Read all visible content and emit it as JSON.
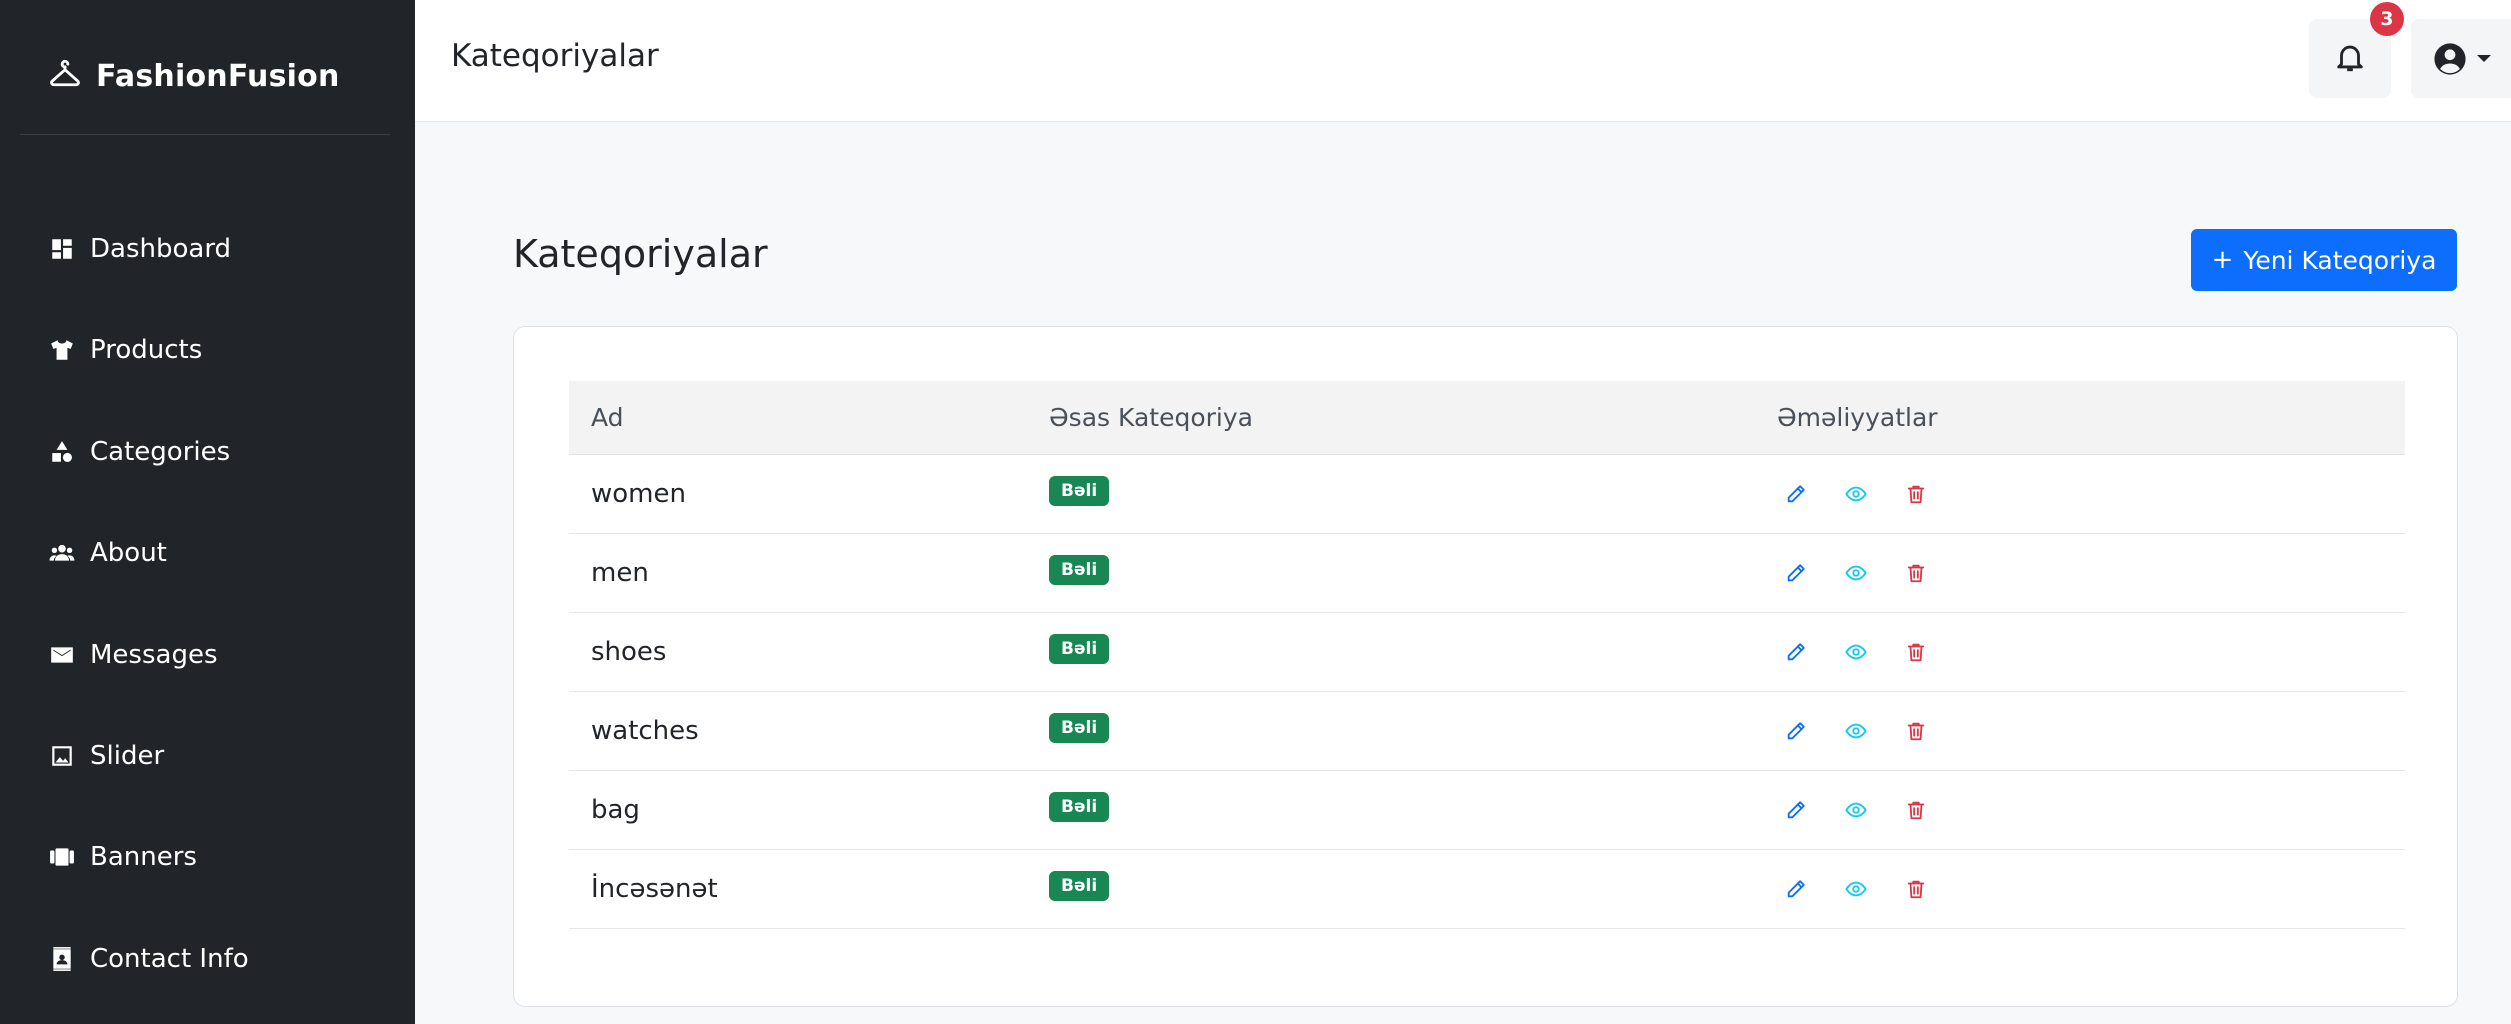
{
  "brand": {
    "name": "FashionFusion"
  },
  "sidebar": {
    "items": [
      {
        "label": "Dashboard",
        "icon": "dashboard-icon"
      },
      {
        "label": "Products",
        "icon": "shirt-icon"
      },
      {
        "label": "Categories",
        "icon": "shapes-icon"
      },
      {
        "label": "About",
        "icon": "users-icon"
      },
      {
        "label": "Messages",
        "icon": "envelope-icon"
      },
      {
        "label": "Slider",
        "icon": "image-icon"
      },
      {
        "label": "Banners",
        "icon": "carousel-icon"
      },
      {
        "label": "Contact Info",
        "icon": "contact-card-icon"
      }
    ]
  },
  "header": {
    "title": "Kateqoriyalar",
    "notification_count": "3"
  },
  "main": {
    "title": "Kateqoriyalar",
    "new_button_label": "Yeni Kateqoriya",
    "new_button_plus": "+"
  },
  "table": {
    "columns": [
      "Ad",
      "Əsas Kateqoriya",
      "Əməliyyatlar"
    ],
    "rows": [
      {
        "name": "women",
        "main": "Bəli"
      },
      {
        "name": "men",
        "main": "Bəli"
      },
      {
        "name": "shoes",
        "main": "Bəli"
      },
      {
        "name": "watches",
        "main": "Bəli"
      },
      {
        "name": "bag",
        "main": "Bəli"
      },
      {
        "name": "İncəsənət",
        "main": "Bəli"
      }
    ]
  },
  "colors": {
    "sidebar_bg": "#212529",
    "primary": "#0d6efd",
    "success": "#198754",
    "danger": "#dc3545",
    "info": "#0dcaf0"
  }
}
